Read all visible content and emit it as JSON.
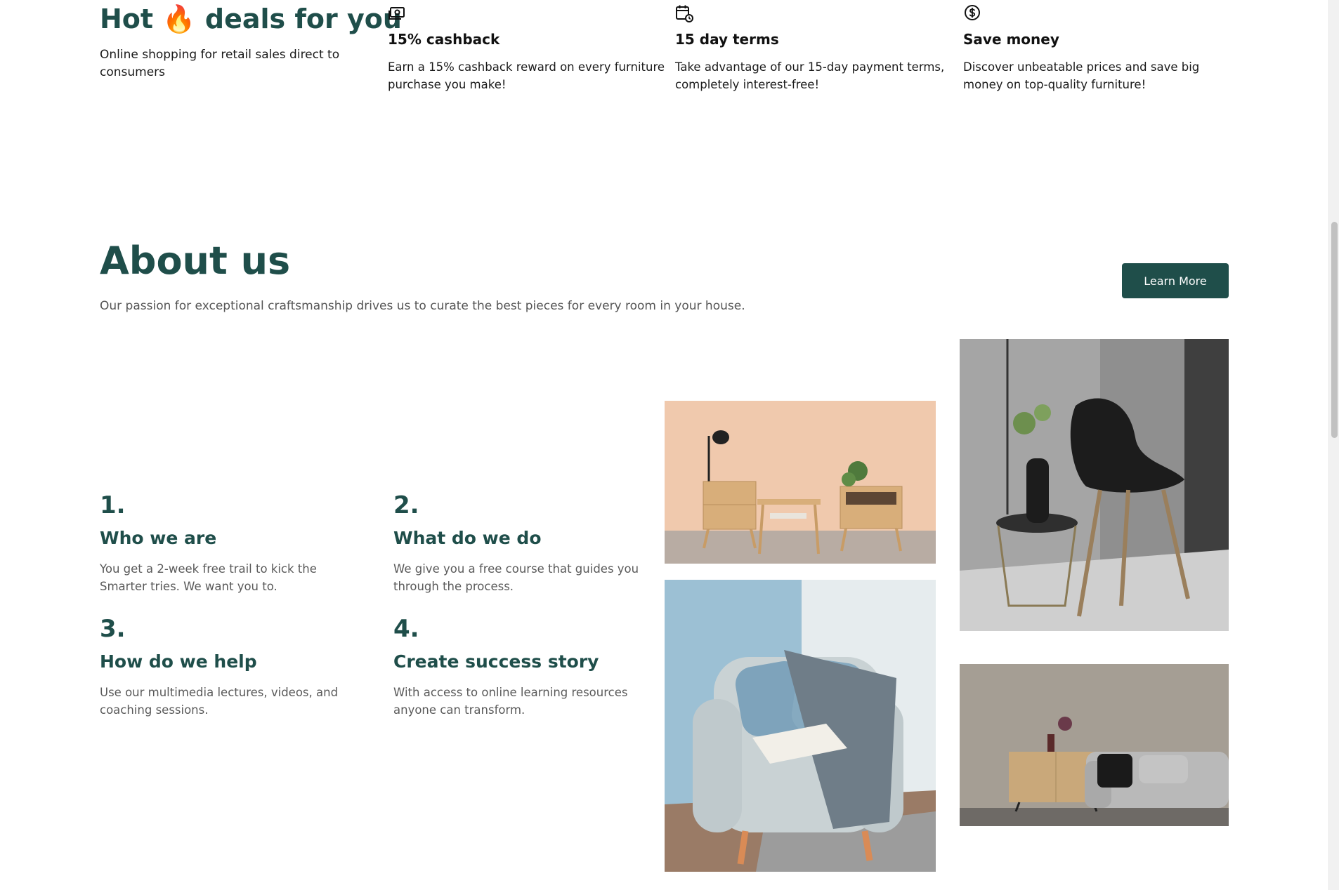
{
  "deals": {
    "title_before": "Hot",
    "title_emoji": "🔥",
    "title_after": "deals for you",
    "subtitle": "Online shopping for retail sales direct to consumers",
    "features": [
      {
        "icon": "cash-icon",
        "title": "15% cashback",
        "description": "Earn a 15% cashback reward on every furniture purchase you make!"
      },
      {
        "icon": "calendar-icon",
        "title": "15 day terms",
        "description": "Take advantage of our 15-day payment terms, completely interest-free!"
      },
      {
        "icon": "dollar-circle-icon",
        "title": "Save money",
        "description": "Discover unbeatable prices and save big money on top-quality furniture!"
      }
    ]
  },
  "about": {
    "title": "About us",
    "subtitle": "Our passion for exceptional craftsmanship drives us to curate the best pieces for every room in your house.",
    "learn_more": "Learn More",
    "steps": [
      {
        "number": "1.",
        "title": "Who we are",
        "description": "You get a 2-week free trail to kick the Smarter tries. We want you to."
      },
      {
        "number": "2.",
        "title": "What do we do",
        "description": "We give you a free course that guides you through the process."
      },
      {
        "number": "3.",
        "title": "How do we help",
        "description": "Use our multimedia lectures, videos, and coaching sessions."
      },
      {
        "number": "4.",
        "title": "Create success story",
        "description": "With access to online learning resources anyone can transform."
      }
    ]
  },
  "colors": {
    "brand": "#1f4e4a",
    "text": "#1a1a1a",
    "muted": "#555555"
  }
}
